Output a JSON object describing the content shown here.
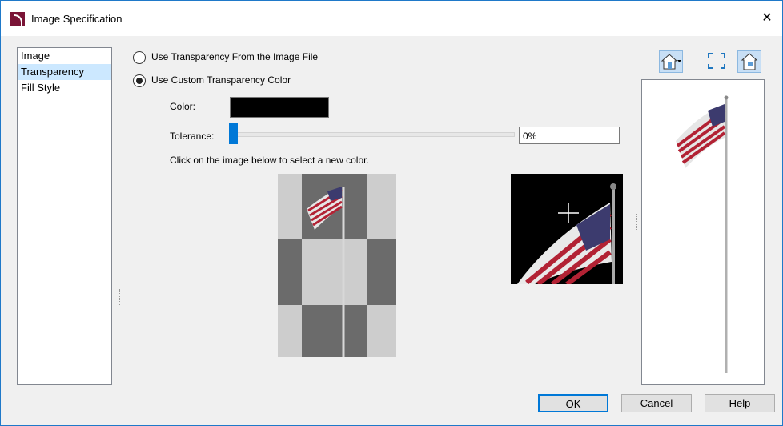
{
  "window": {
    "title": "Image Specification",
    "close_glyph": "✕"
  },
  "nav": {
    "items": [
      "Image",
      "Transparency",
      "Fill Style"
    ],
    "selected_index": 1
  },
  "transparency": {
    "option_file": "Use Transparency From the Image File",
    "option_custom": "Use Custom Transparency Color",
    "selected_option": "custom",
    "color_label": "Color:",
    "color_value": "#000000",
    "tolerance_label": "Tolerance:",
    "tolerance_value": "0%",
    "instruction": "Click on the image below to select a new color."
  },
  "icons": {
    "house_dropdown": "house-view-icon",
    "fit": "fit-to-window-icon",
    "view_toggle": "view-toggle-icon"
  },
  "footer": {
    "ok": "OK",
    "cancel": "Cancel",
    "help": "Help"
  }
}
